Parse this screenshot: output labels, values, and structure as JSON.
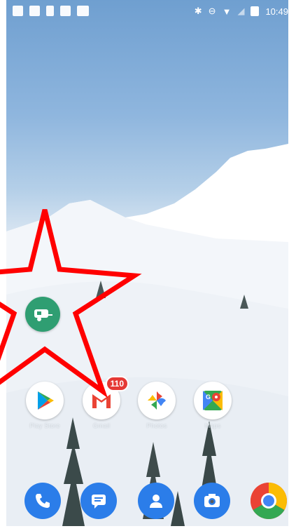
{
  "status_bar": {
    "time": "10:49",
    "left_icons": [
      "notification-icon",
      "image-icon",
      "sim-icon",
      "photo-icon",
      "mail-icon"
    ],
    "right_icons": [
      "bluetooth-icon",
      "do-not-disturb-icon",
      "wifi-icon",
      "signal-icon",
      "battery-icon"
    ]
  },
  "home": {
    "highlighted_app": {
      "label": "",
      "icon": "camper-trailer-icon",
      "color": "#2f9e72"
    },
    "apps": [
      {
        "name": "Play Store",
        "icon": "play-store-icon"
      },
      {
        "name": "Gmail",
        "icon": "gmail-icon",
        "badge": "110"
      },
      {
        "name": "Photos",
        "icon": "photos-icon"
      },
      {
        "name": "Maps",
        "icon": "maps-icon"
      }
    ]
  },
  "dock": [
    {
      "name": "Phone",
      "icon": "phone-icon",
      "color": "#2b7de9"
    },
    {
      "name": "Messages",
      "icon": "messages-icon",
      "color": "#2b7de9"
    },
    {
      "name": "Contacts",
      "icon": "contacts-icon",
      "color": "#2b7de9"
    },
    {
      "name": "Camera",
      "icon": "camera-icon",
      "color": "#2b7de9"
    },
    {
      "name": "Chrome",
      "icon": "chrome-icon",
      "color": "#e53935"
    }
  ],
  "annotation": {
    "shape": "star",
    "color": "#ff0000"
  }
}
